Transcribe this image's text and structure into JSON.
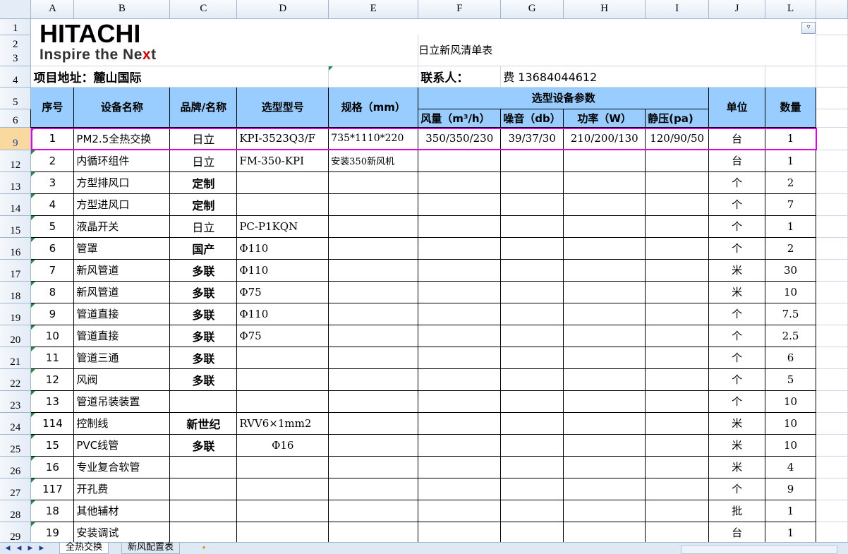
{
  "columns": [
    "A",
    "B",
    "C",
    "D",
    "E",
    "F",
    "G",
    "H",
    "I",
    "J",
    "L"
  ],
  "logo": {
    "brand": "HITACHI",
    "tagline_a": "Inspire the Ne",
    "tagline_x": "x",
    "tagline_b": "t"
  },
  "title": "日立新风清单表",
  "address_label": "项目地址：麓山国际",
  "contact_label": "联系人：",
  "contact_value": "费 13684044612",
  "headers": {
    "seq": "序号",
    "name": "设备名称",
    "brand": "品牌/名称",
    "model": "选型型号",
    "spec": "规格（mm）",
    "params": "选型设备参数",
    "airflow": "风量（m³/h）",
    "noise": "噪音（db）",
    "power": "功率（W）",
    "pressure": "静压(pa)",
    "unit": "单位",
    "qty": "数量"
  },
  "row_numbers": {
    "r1": "1",
    "r2": "2",
    "r3": "3",
    "r4": "4",
    "r5": "5",
    "r6": "6"
  },
  "rows": [
    {
      "row": "9",
      "seq": "1",
      "name": "PM2.5全热交换",
      "brand": "日立",
      "model": "KPI-3523Q3/F",
      "spec": "735*1110*220",
      "airflow": "350/350/230",
      "noise": "39/37/30",
      "power": "210/200/130",
      "pressure": "120/90/50",
      "unit": "台",
      "qty": "1"
    },
    {
      "row": "12",
      "seq": "2",
      "name": "内循环组件",
      "brand": "日立",
      "model": "FM-350-KPI",
      "spec": "安装350新风机",
      "airflow": "",
      "noise": "",
      "power": "",
      "pressure": "",
      "unit": "台",
      "qty": "1"
    },
    {
      "row": "13",
      "seq": "3",
      "name": "方型排风口",
      "brand": "定制",
      "model": "",
      "spec": "",
      "airflow": "",
      "noise": "",
      "power": "",
      "pressure": "",
      "unit": "个",
      "qty": "2"
    },
    {
      "row": "14",
      "seq": "4",
      "name": "方型进风口",
      "brand": "定制",
      "model": "",
      "spec": "",
      "airflow": "",
      "noise": "",
      "power": "",
      "pressure": "",
      "unit": "个",
      "qty": "7"
    },
    {
      "row": "15",
      "seq": "5",
      "name": "液晶开关",
      "brand": "日立",
      "model": "PC-P1KQN",
      "spec": "",
      "airflow": "",
      "noise": "",
      "power": "",
      "pressure": "",
      "unit": "个",
      "qty": "1"
    },
    {
      "row": "16",
      "seq": "6",
      "name": "管罩",
      "brand": "国产",
      "model": "Φ110",
      "spec": "",
      "airflow": "",
      "noise": "",
      "power": "",
      "pressure": "",
      "unit": "个",
      "qty": "2"
    },
    {
      "row": "17",
      "seq": "7",
      "name": "新风管道",
      "brand": "多联",
      "model": "Φ110",
      "spec": "",
      "airflow": "",
      "noise": "",
      "power": "",
      "pressure": "",
      "unit": "米",
      "qty": "30"
    },
    {
      "row": "18",
      "seq": "8",
      "name": "新风管道",
      "brand": "多联",
      "model": "Φ75",
      "spec": "",
      "airflow": "",
      "noise": "",
      "power": "",
      "pressure": "",
      "unit": "米",
      "qty": "10"
    },
    {
      "row": "19",
      "seq": "9",
      "name": "管道直接",
      "brand": "多联",
      "model": "Φ110",
      "spec": "",
      "airflow": "",
      "noise": "",
      "power": "",
      "pressure": "",
      "unit": "个",
      "qty": "7.5"
    },
    {
      "row": "20",
      "seq": "10",
      "name": "管道直接",
      "brand": "多联",
      "model": "Φ75",
      "spec": "",
      "airflow": "",
      "noise": "",
      "power": "",
      "pressure": "",
      "unit": "个",
      "qty": "2.5"
    },
    {
      "row": "21",
      "seq": "11",
      "name": "管道三通",
      "brand": "多联",
      "model": "",
      "spec": "",
      "airflow": "",
      "noise": "",
      "power": "",
      "pressure": "",
      "unit": "个",
      "qty": "6"
    },
    {
      "row": "22",
      "seq": "12",
      "name": "风阀",
      "brand": "多联",
      "model": "",
      "spec": "",
      "airflow": "",
      "noise": "",
      "power": "",
      "pressure": "",
      "unit": "个",
      "qty": "5"
    },
    {
      "row": "23",
      "seq": "13",
      "name": "管道吊装装置",
      "brand": "",
      "model": "",
      "spec": "",
      "airflow": "",
      "noise": "",
      "power": "",
      "pressure": "",
      "unit": "个",
      "qty": "10"
    },
    {
      "row": "24",
      "seq": "114",
      "name": "控制线",
      "brand": "新世纪",
      "model": "RVV6×1mm2",
      "spec": "",
      "airflow": "",
      "noise": "",
      "power": "",
      "pressure": "",
      "unit": "米",
      "qty": "10"
    },
    {
      "row": "25",
      "seq": "15",
      "name": "PVC线管",
      "brand": "多联",
      "model": "Φ16",
      "spec": "",
      "airflow": "",
      "noise": "",
      "power": "",
      "pressure": "",
      "unit": "米",
      "qty": "10"
    },
    {
      "row": "26",
      "seq": "16",
      "name": "专业复合软管",
      "brand": "",
      "model": "",
      "spec": "",
      "airflow": "",
      "noise": "",
      "power": "",
      "pressure": "",
      "unit": "米",
      "qty": "4"
    },
    {
      "row": "27",
      "seq": "117",
      "name": "开孔费",
      "brand": "",
      "model": "",
      "spec": "",
      "airflow": "",
      "noise": "",
      "power": "",
      "pressure": "",
      "unit": "个",
      "qty": "9"
    },
    {
      "row": "28",
      "seq": "18",
      "name": "其他辅材",
      "brand": "",
      "model": "",
      "spec": "",
      "airflow": "",
      "noise": "",
      "power": "",
      "pressure": "",
      "unit": "批",
      "qty": "1"
    },
    {
      "row": "29",
      "seq": "19",
      "name": "安装调试",
      "brand": "",
      "model": "",
      "spec": "",
      "airflow": "",
      "noise": "",
      "power": "",
      "pressure": "",
      "unit": "台",
      "qty": "1"
    }
  ],
  "sheet_tabs": [
    "全热交换",
    "新风配置表"
  ],
  "filter_icon": "autofilter-icon",
  "colors": {
    "header_blue": "#99ccff",
    "highlight": "#e000e0",
    "selected_row": "#f9d99f"
  }
}
